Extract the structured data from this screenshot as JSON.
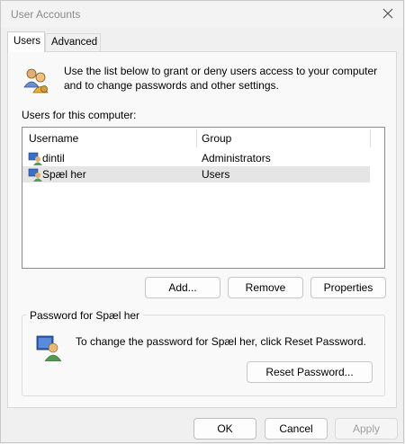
{
  "window": {
    "title": "User Accounts"
  },
  "tabs": [
    {
      "label": "Users"
    },
    {
      "label": "Advanced"
    }
  ],
  "intro": "Use the list below to grant or deny users access to your computer and to change passwords and other settings.",
  "users_label": "Users for this computer:",
  "list": {
    "columns": [
      "Username",
      "Group"
    ],
    "rows": [
      {
        "username": "dintil",
        "group": "Administrators"
      },
      {
        "username": "Spæl her",
        "group": "Users"
      }
    ]
  },
  "buttons": {
    "add": "Add...",
    "remove": "Remove",
    "properties": "Properties",
    "reset": "Reset Password...",
    "ok": "OK",
    "cancel": "Cancel",
    "apply": "Apply"
  },
  "password": {
    "legend": "Password for Spæl her",
    "text": "To change the password for Spæl her, click Reset Password."
  }
}
